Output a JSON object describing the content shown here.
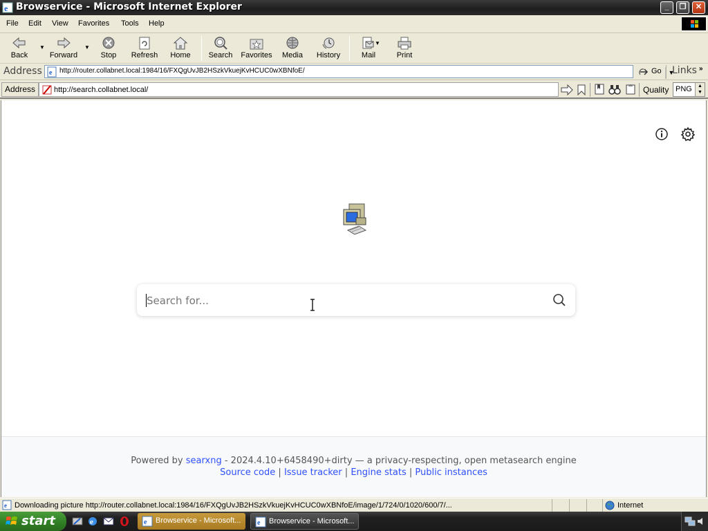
{
  "window": {
    "title": "Browservice - Microsoft Internet Explorer",
    "controls": [
      "minimize",
      "restore",
      "close"
    ]
  },
  "menu": {
    "items": [
      "File",
      "Edit",
      "View",
      "Favorites",
      "Tools",
      "Help"
    ]
  },
  "toolbar": {
    "buttons": [
      "Back",
      "Forward",
      "Stop",
      "Refresh",
      "Home",
      "Search",
      "Favorites",
      "Media",
      "History",
      "Mail",
      "Print"
    ]
  },
  "address_bar": {
    "label": "Address",
    "url": "http://router.collabnet.local:1984/16/FXQgUvJB2HSzkVkuejKvHCUC0wXBNfoE/",
    "go_label": "Go",
    "links_label": "Links"
  },
  "browservice_bar": {
    "label": "Address",
    "url": "http://search.collabnet.local/",
    "quality_label": "Quality",
    "quality_value": "PNG"
  },
  "page": {
    "search_placeholder": "Search for...",
    "footer": {
      "powered_by": "Powered by",
      "engine_link": "searxng",
      "version_text": "- 2024.4.10+6458490+dirty — a privacy-respecting, open metasearch engine",
      "links": [
        "Source code",
        "Issue tracker",
        "Engine stats",
        "Public instances"
      ],
      "separator": "|"
    }
  },
  "statusbar": {
    "text": "Downloading picture http://router.collabnet.local:1984/16/FXQgUvJB2HSzkVkuejKvHCUC0wXBNfoE/image/1/724/0/1020/600/7/...",
    "zone": "Internet"
  },
  "taskbar": {
    "start_label": "start",
    "tasks": [
      "Browservice - Microsoft...",
      "Browservice - Microsoft..."
    ]
  },
  "colors": {
    "link": "#3050ff",
    "xp_green": "#2f7d24"
  }
}
